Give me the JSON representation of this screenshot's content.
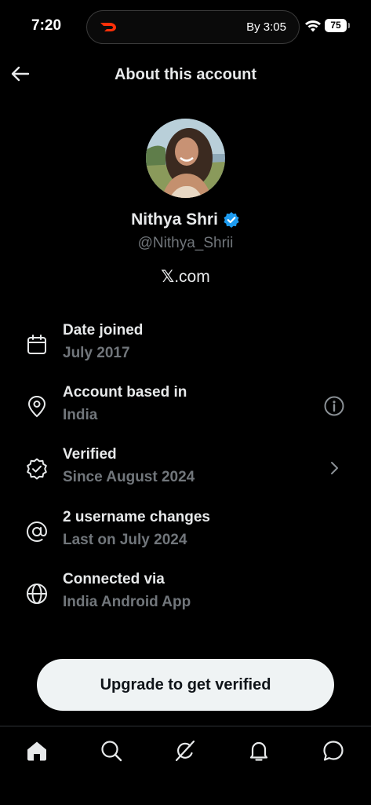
{
  "status_bar": {
    "time": "7:20",
    "live_activity_eta": "By 3:05",
    "battery": "75"
  },
  "header": {
    "title": "About this account"
  },
  "profile": {
    "name": "Nithya Shri",
    "handle": "@Nithya_Shrii",
    "site_logo": "𝕏",
    "site_suffix": ".com",
    "verified": true
  },
  "info_rows": [
    {
      "icon": "calendar-icon",
      "title": "Date joined",
      "subtitle": "July 2017"
    },
    {
      "icon": "location-pin-icon",
      "title": "Account based in",
      "subtitle": "India",
      "action": "info-icon"
    },
    {
      "icon": "verified-badge-outline-icon",
      "title": "Verified",
      "subtitle": "Since August 2024",
      "action": "chevron-right-icon"
    },
    {
      "icon": "at-sign-icon",
      "title": "2 username changes",
      "subtitle": "Last on July 2024"
    },
    {
      "icon": "globe-icon",
      "title": "Connected via",
      "subtitle": "India Android App"
    }
  ],
  "cta": {
    "label": "Upgrade to get verified"
  },
  "bottom_nav": [
    "home-icon",
    "search-icon",
    "grok-icon",
    "notifications-icon",
    "messages-icon"
  ],
  "colors": {
    "background": "#000000",
    "primary_text": "#e7e9ea",
    "secondary_text": "#71767b",
    "verified_blue": "#1d9bf0",
    "button_bg": "#eff3f4"
  }
}
